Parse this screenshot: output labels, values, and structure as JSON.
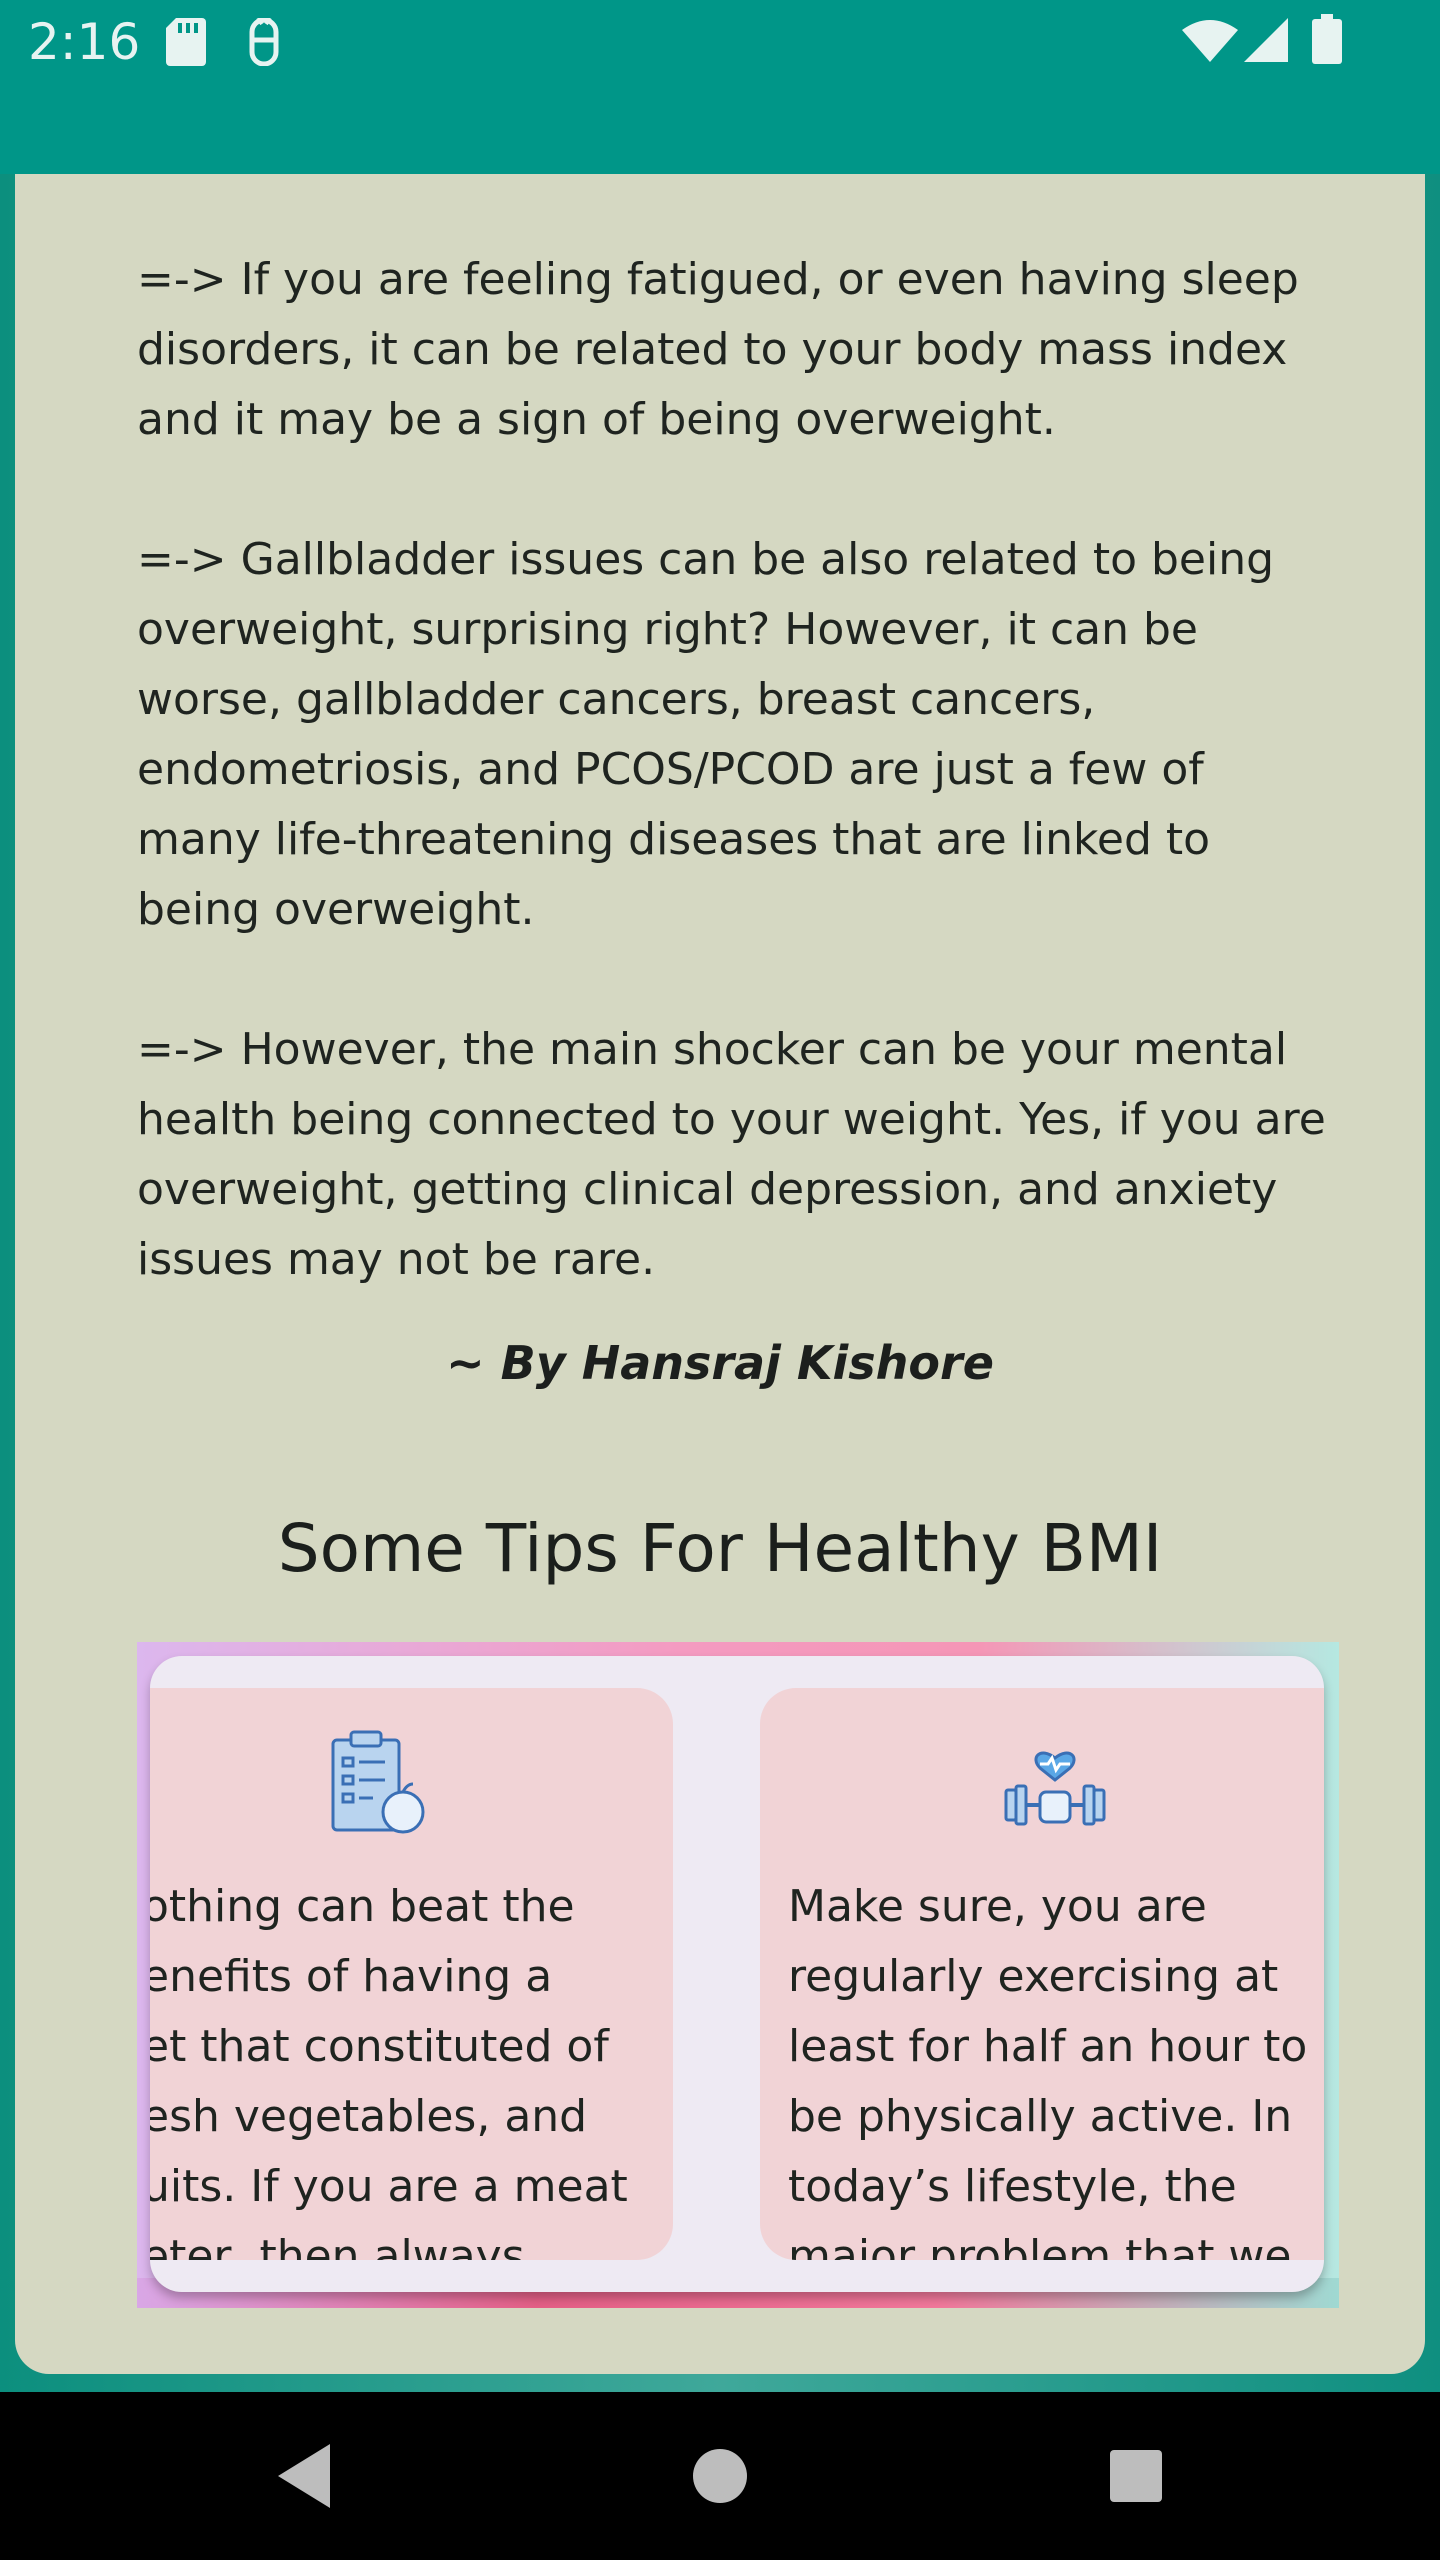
{
  "status_bar": {
    "time": "2:16",
    "icons": [
      "sd-card-icon",
      "debug-icon",
      "wifi-icon",
      "signal-icon",
      "battery-icon"
    ]
  },
  "article": {
    "paragraphs": [
      "=-> If you are feeling fatigued, or even having sleep\ndisorders, it can be related to your body mass index\nand it may be a sign of being overweight.",
      "=-> Gallbladder issues can be also related to being\noverweight, surprising right? However, it can be\nworse, gallbladder cancers, breast cancers,\nendometriosis, and PCOS/PCOD are just a few of\nmany life-threatening diseases that are linked to\nbeing overweight.",
      "=-> However, the main shocker can be your mental\nhealth being connected to your weight. Yes, if you are\noverweight, getting clinical depression, and anxiety\nissues may not be rare."
    ],
    "author": "~ By Hansraj Kishore"
  },
  "tips": {
    "heading": "Some Tips For Healthy BMI",
    "cards": [
      {
        "icon": "clipboard-apple-icon",
        "text_visible": "othing can beat the\nenefits of having a\net that constituted of\nesh vegetables, and\nuits. If you are a meat\neter, then always"
      },
      {
        "icon": "dumbbell-heart-icon",
        "text_visible": "Make sure, you are\nregularly exercising at\nleast for half an hour to\nbe physically active. In\ntoday’s lifestyle, the\nmajor problem that we"
      }
    ]
  },
  "colors": {
    "status_bar": "#009688",
    "card_bg": "#d5d8c2",
    "tip_card_bg": "#f1d3d6"
  },
  "nav": {
    "buttons": [
      "back-icon",
      "home-icon",
      "recents-icon"
    ]
  }
}
